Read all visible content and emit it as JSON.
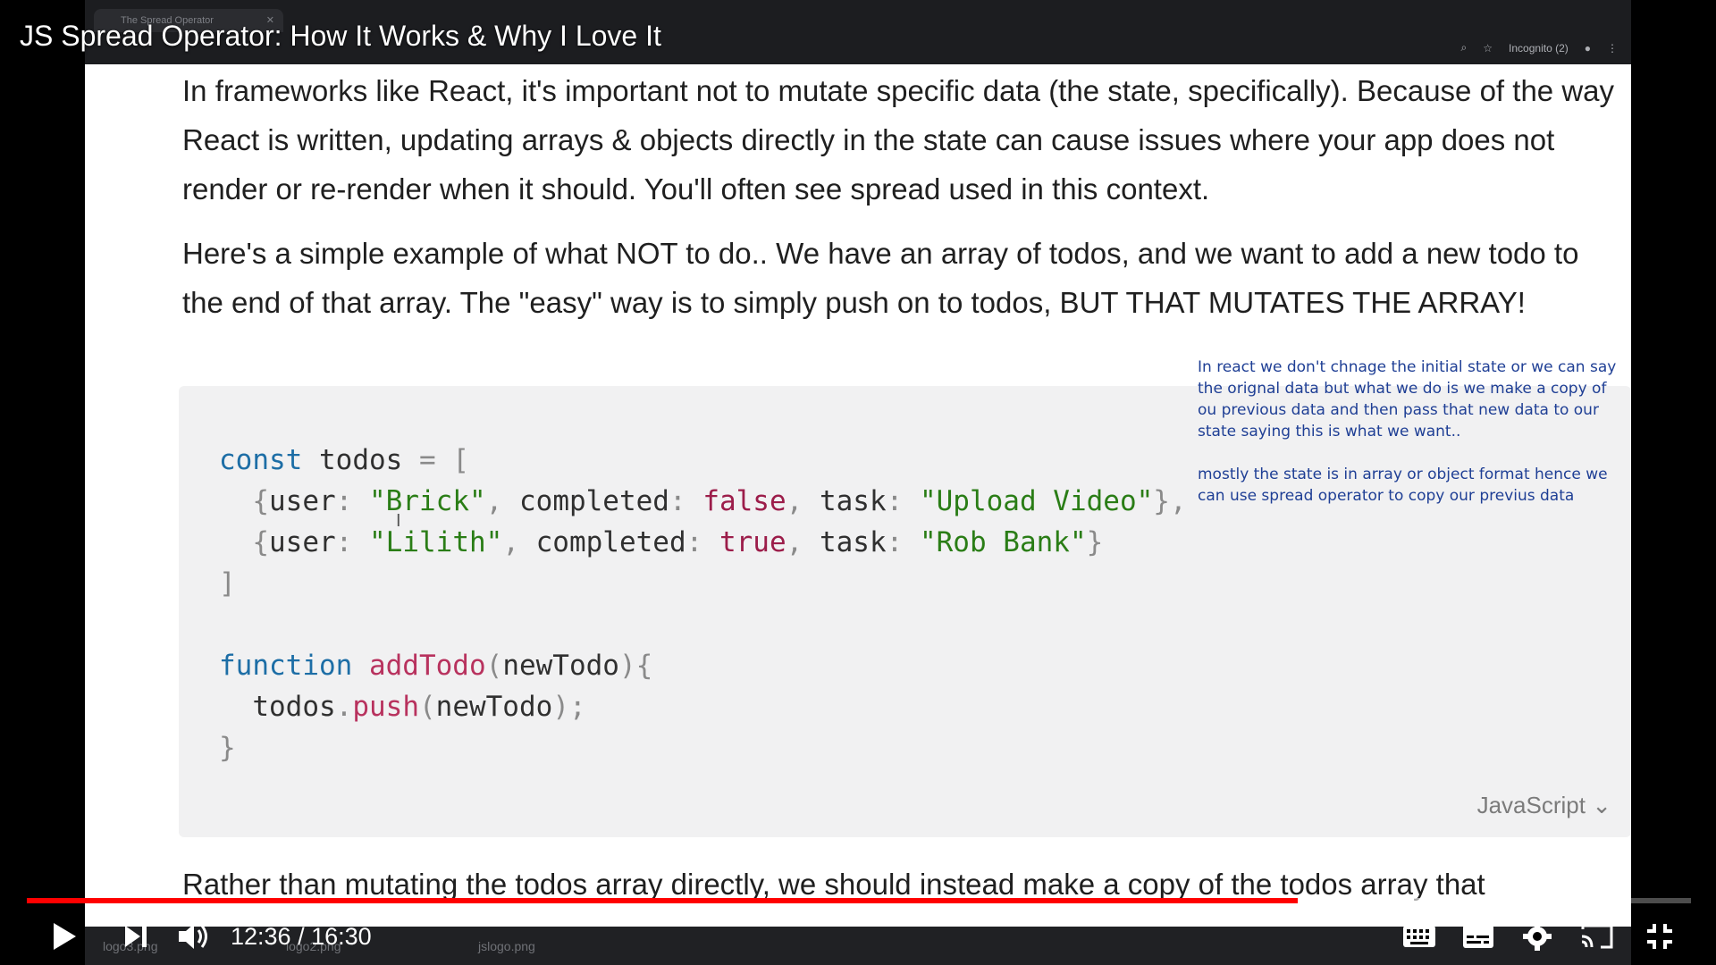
{
  "video": {
    "title": "JS Spread Operator: How It Works & Why I Love It",
    "current_time": "12:36",
    "duration": "16:30",
    "time_display": "12:36 / 16:30",
    "progress_fraction": 0.7636,
    "buffered_fraction": 0.89
  },
  "browser": {
    "tab_title": "The Spread Operator",
    "incognito_label": "Incognito (2)",
    "downloads": [
      "logo3.png",
      "logo2.png",
      "jslogo.png"
    ]
  },
  "content": {
    "paragraph1": "In frameworks like React, it's important not to mutate specific data (the state, specifically).  Because of the way React is written, updating arrays & objects directly in the state can cause issues where your app does not render or re-render when it should.   You'll often see spread used in this context.",
    "paragraph2": "Here's a simple example of what NOT to do..  We have an array of todos, and we want to add a new todo to the end of that array.  The \"easy\" way is to simply push on to todos, BUT THAT MUTATES THE ARRAY!",
    "paragraph3": "Rather than mutating the todos array directly, we should instead make a copy of the todos array that",
    "code_language": "JavaScript",
    "annotation": "In react we don't chnage the initial state or we can say the orignal data but what we do is we make a copy of ou previous data and then pass that new data to our state saying this is what we want..\n\nmostly the state is in array or object format hence we can use spread operator to copy our previus data"
  },
  "colors": {
    "progress": "#ff0000",
    "annotation_text": "#1f3f95",
    "code_keyword": "#1d6ea6",
    "code_string": "#2a7d16"
  },
  "icons": [
    "play-icon",
    "next-icon",
    "volume-icon",
    "chevron-down-icon",
    "keyboard-icon",
    "subtitles-icon",
    "settings-icon",
    "cast-icon",
    "exit-fullscreen-icon"
  ]
}
